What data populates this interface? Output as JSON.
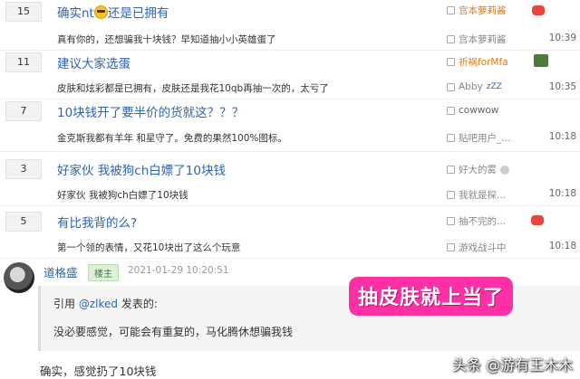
{
  "threads": [
    {
      "count": "15",
      "title": "确实nt",
      "title_suffix": "还是已拥有",
      "has_emoji": true,
      "top_author": "宫本萝莉酱",
      "top_author_color": "#e07b1a",
      "preview": "真有你的，还想骗我十块钱？早知道抽小小英雄蛋了",
      "last_author": "宫本萝莉酱",
      "last_time": "10:39"
    },
    {
      "count": "11",
      "title": "建议大家选蛋",
      "title_suffix": "",
      "has_emoji": false,
      "top_author": "祈祸forMfa",
      "top_author_color": "#e07b1a",
      "preview": "皮肤和炫彩都是已拥有，皮肤还是我花10qb再抽一次的，太亏了",
      "last_author": "Abby",
      "last_author_suffix": "zZZ",
      "last_time": "10:35"
    },
    {
      "count": "7",
      "title": "10块钱开了要半价的货就这？？？",
      "title_suffix": "",
      "has_emoji": false,
      "top_author": "cowwow",
      "top_author_color": "#666666",
      "preview": "金克斯我都有羊年 和星守了。免费的果然100%图标。",
      "last_author": "贴吧用户_...",
      "last_time": "10:18"
    },
    {
      "count": "3",
      "title": "好家伙 我被狗ch白嫖了10块钱",
      "title_suffix": "",
      "has_emoji": false,
      "top_author": "好大的雾",
      "top_author_color": "#888888",
      "preview": "好家伙 我被狗ch白嫖了10块钱",
      "last_author": "我就是探...",
      "last_time": "10:18"
    },
    {
      "count": "5",
      "title": "有比我背的么?",
      "title_suffix": "",
      "has_emoji": false,
      "top_author": "抽不完的...",
      "top_author_color": "#888888",
      "preview": "第一个领的表情，又花10块出了这么个玩意",
      "last_author": "游戏战斗中",
      "last_time": "10:18"
    }
  ],
  "post": {
    "author": "道格盛",
    "owner_tag": "楼主",
    "time": "2021-01-29 10:20:51",
    "quote_prefix": "引用",
    "quote_user": "@zlked",
    "quote_suffix": "发表的:",
    "quote_text": "没必要感觉，可能会有重复的，马化腾休想骗我钱",
    "reply_text": "确实，感觉扔了10块钱"
  },
  "sticker_text": "抽皮肤就上当了",
  "watermark": "头条 @游有王木木",
  "icons": {
    "author_badge": "person-icon",
    "thread_emoji": "grinning-emoji-icon"
  }
}
